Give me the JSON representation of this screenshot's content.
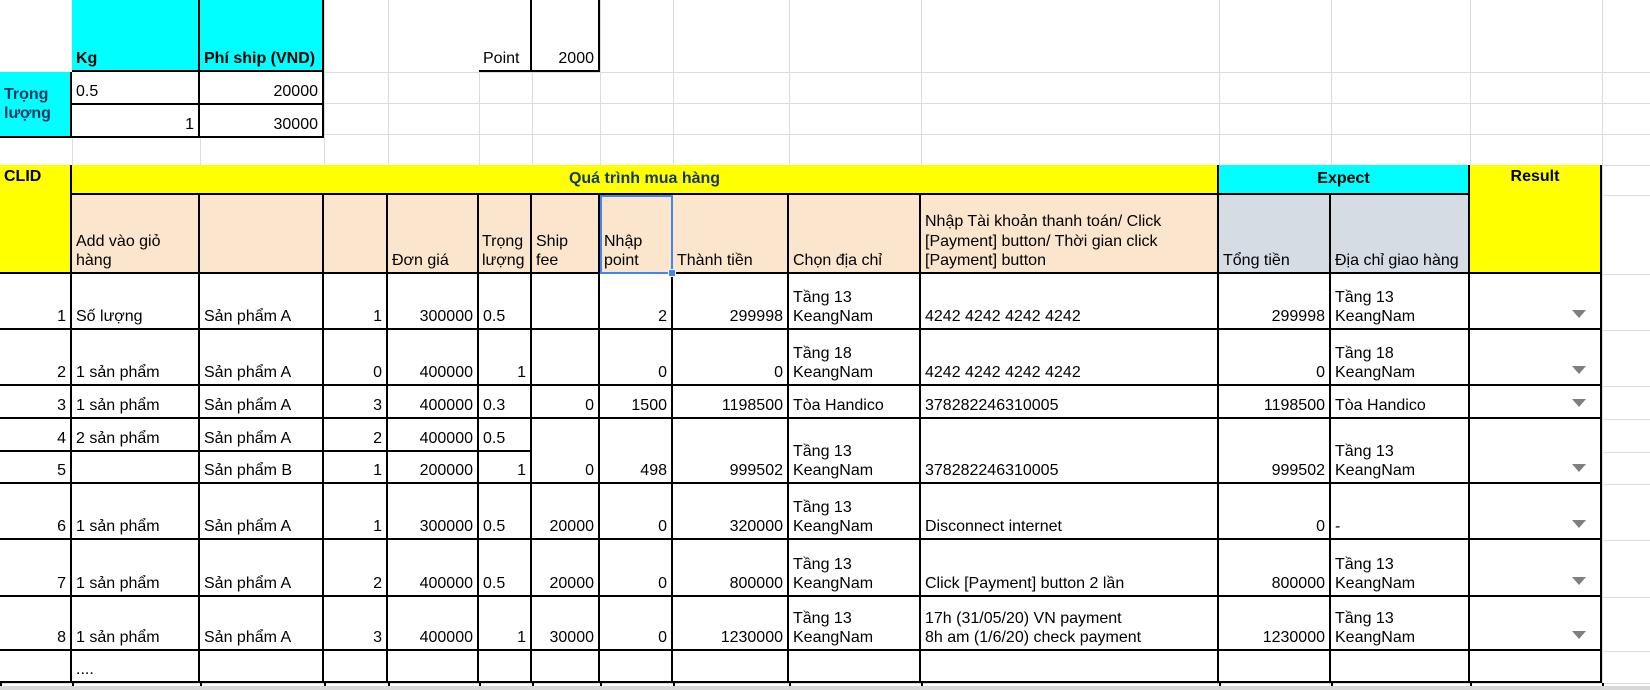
{
  "colors": {
    "cyan": "#00ffff",
    "yellow": "#ffff00",
    "tan": "#fce5cd",
    "blue_gray": "#d6dce4",
    "selection_blue": "#4285f4",
    "header_text_blue": "#17375d"
  },
  "weight_table": {
    "label": "Trọng lượng",
    "headers": [
      "Kg",
      "Phí ship (VND)"
    ],
    "rows": [
      {
        "kg": "0.5",
        "fee": "20000"
      },
      {
        "kg": "1",
        "fee": "30000"
      }
    ]
  },
  "point": {
    "label": "Point",
    "value": "2000"
  },
  "table": {
    "clid_header": "CLID",
    "process_header": "Quá trình mua hàng",
    "expect_header": "Expect",
    "result_header": "Result",
    "columns": {
      "add": "Add vào giỏ hàng",
      "price": "Đơn giá",
      "weight": "Trọng lượng",
      "ship": "Ship fee",
      "point": "Nhập point",
      "amount": "Thành tiền",
      "address": "Chọn địa chỉ",
      "payment": "Nhập Tài khoản thanh toán/ Click [Payment] button/ Thời gian click [Payment] button",
      "total": "Tổng tiền",
      "delivery": "Địa chỉ giao hàng"
    },
    "rows": [
      {
        "clid": "1",
        "add": "Số lượng",
        "product": "Sản phẩm A",
        "qty": "1",
        "price": "300000",
        "weight": "0.5",
        "weight_align": "left",
        "ship": "",
        "point": "2",
        "amount": "299998",
        "address": "Tầng 13 KeangNam",
        "payment": "4242 4242 4242 4242",
        "total": "299998",
        "delivery": "Tầng 13 KeangNam"
      },
      {
        "clid": "2",
        "add": "1 sản phẩm",
        "product": "Sản phẩm A",
        "qty": "0",
        "price": "400000",
        "weight": "1",
        "weight_align": "right",
        "ship": "",
        "point": "0",
        "amount": "0",
        "address": "Tầng 18 KeangNam",
        "payment": "4242 4242 4242 4242",
        "total": "0",
        "delivery": "Tầng 18 KeangNam"
      },
      {
        "clid": "3",
        "add": "1 sản phẩm",
        "product": "Sản phẩm A",
        "qty": "3",
        "price": "400000",
        "weight": "0.3",
        "weight_align": "left",
        "ship": "0",
        "point": "1500",
        "amount": "1198500",
        "address": "Tòa Handico",
        "payment": "378282246310005",
        "total": "1198500",
        "delivery": "Tòa Handico"
      },
      {
        "clid": "4",
        "add": "2 sản phẩm",
        "product": "Sản phẩm A",
        "qty": "2",
        "price": "400000",
        "weight": "0.5",
        "weight_align": "left"
      },
      {
        "clid": "5",
        "add": "",
        "product": "Sản phẩm B",
        "qty": "1",
        "price": "200000",
        "weight": "1",
        "weight_align": "right",
        "merged_with_prev": true,
        "ship": "0",
        "point": "498",
        "amount": "999502",
        "address": "Tầng 13 KeangNam",
        "payment": "378282246310005",
        "total": "999502",
        "delivery": "Tầng 13 KeangNam"
      },
      {
        "clid": "6",
        "add": "1 sản phẩm",
        "product": "Sản phẩm A",
        "qty": "1",
        "price": "300000",
        "weight": "0.5",
        "weight_align": "left",
        "ship": "20000",
        "point": "0",
        "amount": "320000",
        "address": "Tầng 13 KeangNam",
        "payment": "Disconnect internet",
        "total": "0",
        "delivery": "-"
      },
      {
        "clid": "7",
        "add": "1 sản phẩm",
        "product": "Sản phẩm A",
        "qty": "2",
        "price": "400000",
        "weight": "0.5",
        "weight_align": "left",
        "ship": "20000",
        "point": "0",
        "amount": "800000",
        "address": "Tầng 13 KeangNam",
        "payment": "Click [Payment] button 2 lần",
        "total": "800000",
        "delivery": "Tầng 13 KeangNam"
      },
      {
        "clid": "8",
        "add": "1 sản phẩm",
        "product": "Sản phẩm A",
        "qty": "3",
        "price": "400000",
        "weight": "1",
        "weight_align": "right",
        "ship": "30000",
        "point": "0",
        "amount": "1230000",
        "address": "Tầng 13 KeangNam",
        "payment": "17h (31/05/20) VN payment\n8h am (1/6/20) check payment",
        "total": "1230000",
        "delivery": "Tầng 13 KeangNam"
      }
    ],
    "ellipsis_row": "...."
  }
}
